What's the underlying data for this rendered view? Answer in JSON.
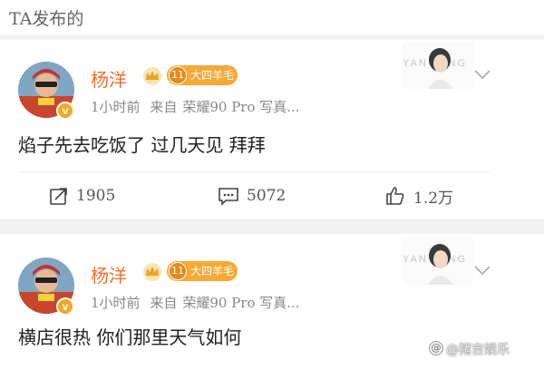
{
  "section_title": "TA发布的",
  "posts": [
    {
      "author": "杨洋",
      "level_num": "11",
      "level_label": "大四羊毛",
      "verified_mark": "v",
      "time": "1小时前",
      "source_prefix": "来自",
      "source": "荣耀90 Pro 写真...",
      "text": "焰子先去吃饭了 过几天见 拜拜",
      "photo_watermark": "YAN  YANG",
      "forwards": "1905",
      "comments": "5072",
      "likes": "1.2万"
    },
    {
      "author": "杨洋",
      "level_num": "11",
      "level_label": "大四羊毛",
      "verified_mark": "v",
      "time": "1小时前",
      "source_prefix": "来自",
      "source": "荣耀90 Pro 写真...",
      "text": "横店很热 你们那里天气如何",
      "photo_watermark": "YAN  YANG"
    }
  ],
  "watermark": {
    "icon": "@",
    "text": "@猪吉娱乐"
  },
  "colors": {
    "name": "#f0712c",
    "level_badge": "#f7a936",
    "verified_badge": "#f5a623",
    "page_gap": "#f2f2f2"
  },
  "icons": [
    "crown-icon",
    "chevron-down-icon",
    "forward-icon",
    "comment-icon",
    "like-icon"
  ]
}
